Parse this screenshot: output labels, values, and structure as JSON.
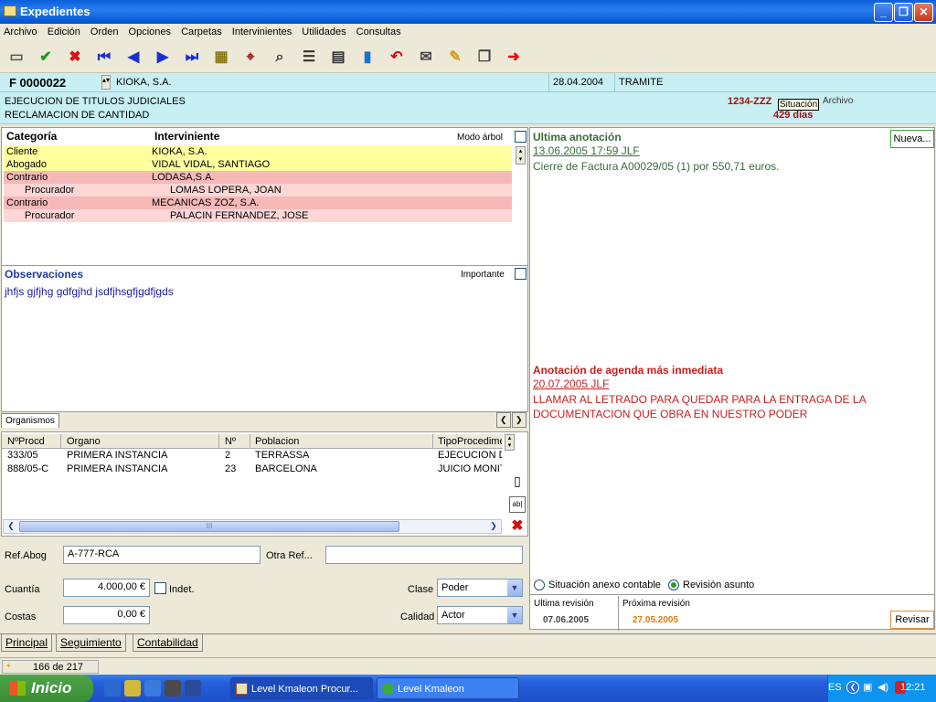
{
  "window": {
    "title": "Expedientes"
  },
  "menu": [
    "Archivo",
    "Edición",
    "Orden",
    "Opciones",
    "Carpetas",
    "Intervinientes",
    "Utilidades",
    "Consultas"
  ],
  "record": {
    "number": "F 0000022",
    "client": "KIOKA, S.A.",
    "date": "28.04.2004",
    "state": "TRAMITE",
    "subject1": "EJECUCION DE TITULOS JUDICIALES",
    "subject2": "RECLAMACION DE CANTIDAD",
    "ref": "1234-ZZZ",
    "days": "429 días",
    "tooltip": "Situación",
    "archivo": "Archivo"
  },
  "participants": {
    "col_categoria": "Categoría",
    "col_interviniente": "Interviniente",
    "modo_arbol": "Modo árbol",
    "rows": [
      {
        "cat": "Cliente",
        "name": "KIOKA, S.A."
      },
      {
        "cat": "Abogado",
        "name": "VIDAL VIDAL, SANTIAGO"
      },
      {
        "cat": "Contrario",
        "name": "LODASA,S.A."
      },
      {
        "cat": "Procurador",
        "name": "LOMAS LOPERA, JOAN"
      },
      {
        "cat": "Contrario",
        "name": "MECANICAS ZOZ, S.A."
      },
      {
        "cat": "Procurador",
        "name": "PALACIN FERNANDEZ, JOSE"
      }
    ]
  },
  "observaciones": {
    "title": "Observaciones",
    "importante": "Importante",
    "text": "jhfjs gjfjhg gdfgjhd jsdfjhsgfjgdfjgds"
  },
  "organismos": {
    "tab": "Organismos",
    "headers": [
      "NºProcd",
      "Organo",
      "Nº",
      "Poblacion",
      "TipoProcedime"
    ],
    "rows": [
      [
        "333/05",
        "PRIMERA INSTANCIA",
        "2",
        "TERRASSA",
        "EJECUCION DE"
      ],
      [
        "888/05-C",
        "PRIMERA INSTANCIA",
        "23",
        "BARCELONA",
        "JUICIO MONITO"
      ]
    ],
    "scroll_mark": "III"
  },
  "form": {
    "ref_abog_label": "Ref.Abog",
    "ref_abog": "A-777-RCA",
    "otra_ref_label": "Otra Ref...",
    "otra_ref": "",
    "cuantia_label": "Cuantía",
    "cuantia": "4.000,00 €",
    "indet": "Indet.",
    "costas_label": "Costas",
    "costas": "0,00 €",
    "clase_label": "Clase",
    "clase": "Poder",
    "calidad_label": "Calidad",
    "calidad": "Actor"
  },
  "anotacion": {
    "title": "Ultima anotación",
    "new_button": "Nueva...",
    "date": "13.06.2005  17:59  JLF",
    "text": "Cierre de Factura A00029/05 (1) por 550,71 euros."
  },
  "agenda": {
    "title": "Anotación de agenda más inmediata",
    "date": "20.07.2005  JLF",
    "text1": "LLAMAR AL LETRADO PARA QUEDAR PARA LA ENTRAGA DE LA",
    "text2": "DOCUMENTACION QUE OBRA EN NUESTRO PODER"
  },
  "revision": {
    "radio1": "Situación anexo contable",
    "radio2": "Revisión asunto",
    "ultima_label": "Ultima revisión",
    "ultima": "07.06.2005",
    "proxima_label": "Próxima revisión",
    "proxima": "27.05.2005",
    "button": "Revisar"
  },
  "bottom_tabs": [
    "Principal",
    "Seguimiento",
    "Contabilidad"
  ],
  "status": {
    "count": "166 de 217"
  },
  "taskbar": {
    "start": "Inicio",
    "tasks": [
      "Level Kmaleon Procur...",
      "Level Kmaleon"
    ],
    "lang": "ES",
    "time": "12:21"
  },
  "colors": {
    "accent": "#1c5180",
    "headerBg": "#c8f0f4",
    "client": "#ffff9e",
    "contrario": "#f7b8b8",
    "proxima": "#e07a10",
    "agenda": "#c81e1e"
  }
}
